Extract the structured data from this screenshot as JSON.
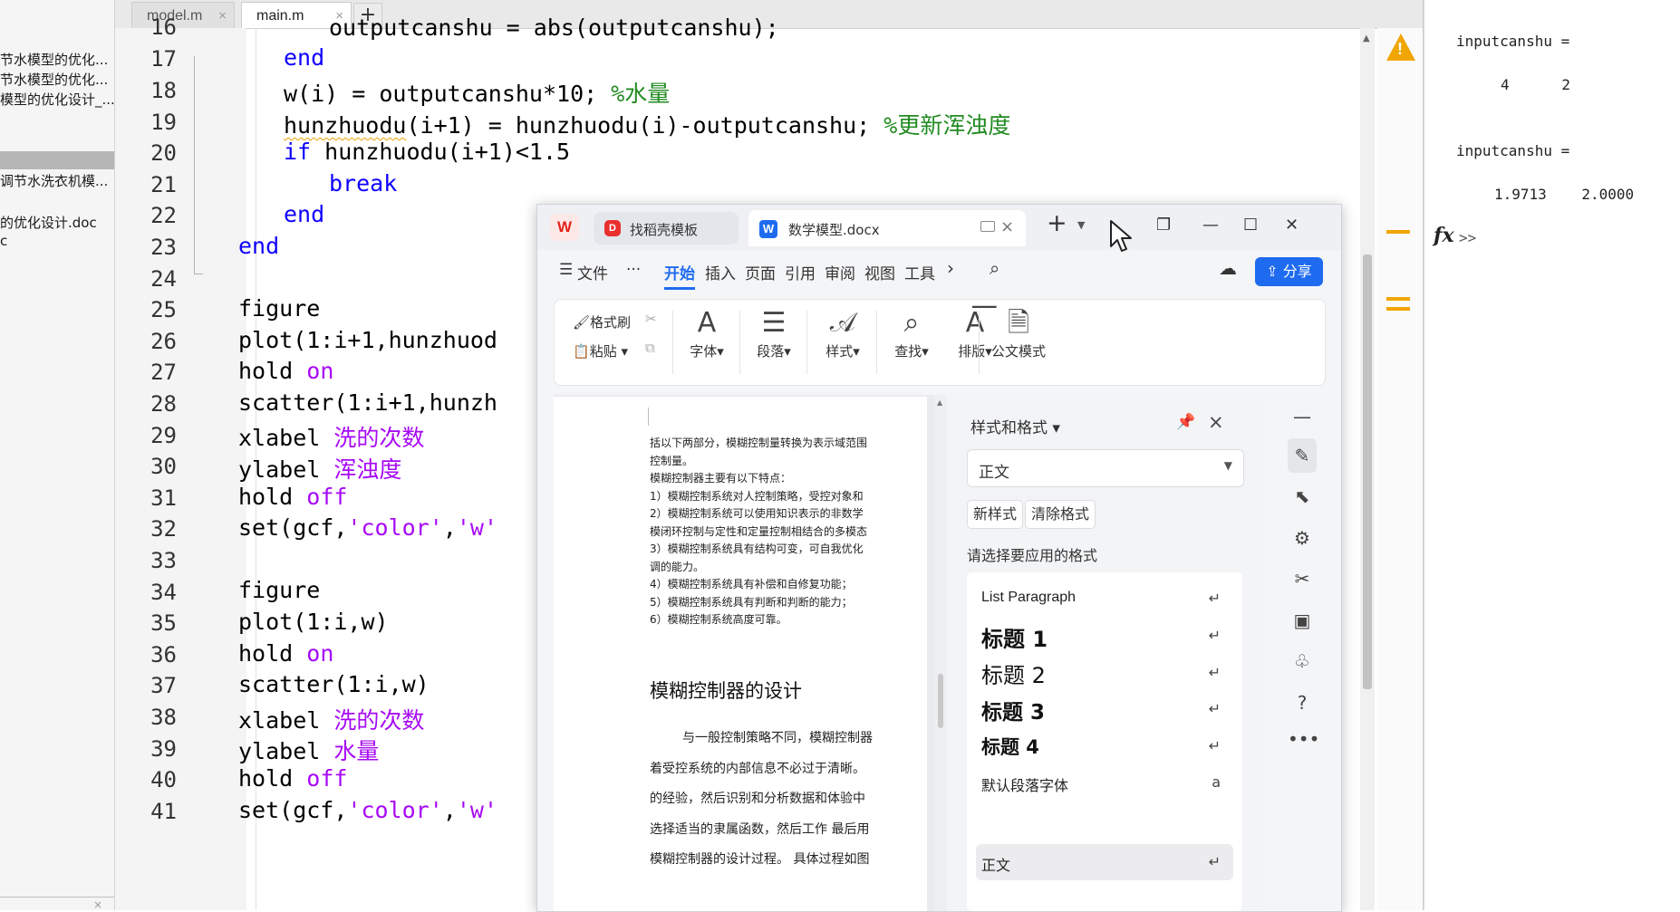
{
  "file_browser": {
    "items": [
      "节水模型的优化...",
      "节水模型的优化...",
      "模型的优化设计_...",
      "调节水洗衣机模...",
      "的优化设计.doc",
      "c"
    ],
    "close_symbol": "×"
  },
  "editor": {
    "tabs": [
      {
        "label": "model.m",
        "close": "×"
      },
      {
        "label": "main.m",
        "close": "×"
      }
    ],
    "new_tab_symbol": "+",
    "line_numbers": [
      "16",
      "17",
      "18",
      "19",
      "20",
      "21",
      "22",
      "23",
      "24",
      "25",
      "26",
      "27",
      "28",
      "29",
      "30",
      "31",
      "32",
      "33",
      "34",
      "35",
      "36",
      "37",
      "38",
      "39",
      "40",
      "41"
    ],
    "code": {
      "l16": "outputcanshu = abs(outputcanshu);",
      "l17_kw": "end",
      "l18_code": "w(i) = outputcanshu*10; ",
      "l18_comment": "%水量",
      "l19_var": "hunzhuodu",
      "l19_code": "(i+1) = hunzhuodu(i)-outputcanshu; ",
      "l19_comment": "%更新浑浊度",
      "l20_kw": "if",
      "l20_code": " hunzhuodu(i+1)<1.5",
      "l21_kw": "break",
      "l22_kw": "end",
      "l23_kw": "end",
      "l25": "figure",
      "l26": "plot(1:i+1,hunzhuod",
      "l27_code": "hold ",
      "l27_str": "on",
      "l28": "scatter(1:i+1,hunzh",
      "l29_code": "xlabel ",
      "l29_str": "洗的次数",
      "l30_code": "ylabel ",
      "l30_str": "浑浊度",
      "l31_code": "hold ",
      "l31_str": "off",
      "l32_a": "set(gcf,",
      "l32_s1": "'color'",
      "l32_b": ",",
      "l32_s2": "'w'",
      "l34": "figure",
      "l35": "plot(1:i,w)",
      "l36_code": "hold ",
      "l36_str": "on",
      "l37": "scatter(1:i,w)",
      "l38_code": "xlabel ",
      "l38_str": "洗的次数",
      "l39_code": "ylabel ",
      "l39_str": "水量",
      "l40_code": "hold ",
      "l40_str": "off",
      "l41_a": "set(gcf,",
      "l41_s1": "'color'",
      "l41_b": ",",
      "l41_s2": "'w'"
    },
    "warning_symbol": "!"
  },
  "command_window": {
    "var1_label": "inputcanshu =",
    "var1_values": "4      2",
    "var2_label": "inputcanshu =",
    "var2_values": "1.9713    2.0000",
    "fx_label": "fx",
    "prompt": ">>"
  },
  "wps": {
    "logo": "W",
    "tabs": [
      {
        "icon": "D",
        "label": "找稻壳模板"
      },
      {
        "icon": "W",
        "label": "数学模型.docx",
        "close": "×"
      }
    ],
    "new_tab": "+",
    "window_controls": {
      "restore_tabs": "❐",
      "minimize": "—",
      "maximize": "☐",
      "close": "✕"
    },
    "ribbon_tabs": [
      "文件",
      "···",
      "开始",
      "插入",
      "页面",
      "引用",
      "审阅",
      "视图",
      "工具"
    ],
    "ribbon_menu_icon": "☰",
    "ribbon_more": "›",
    "share_label": "分享",
    "toolbar": {
      "format_painter": "格式刷",
      "paste": "粘贴",
      "font": "字体",
      "paragraph": "段落",
      "style": "样式",
      "find": "查找",
      "layout": "排版",
      "official_doc": "公文模式"
    },
    "document": {
      "lines": [
        "括以下两部分，模糊控制量转换为表示域范围",
        "控制量。",
        "模糊控制器主要有以下特点：",
        "1）模糊控制系统对人控制策略，受控对象和",
        "2）模糊控制系统可以使用知识表示的非数学",
        "模闭环控制与定性和定量控制相结合的多模态",
        "3）模糊控制系统具有结构可变，可自我优化",
        "调的能力。",
        "4）模糊控制系统具有补偿和自修复功能；",
        "5）模糊控制系统具有判断和判断的能力；",
        "6）模糊控制系统高度可靠。"
      ],
      "heading": "模糊控制器的设计",
      "body": [
        "与一般控制策略不同，模糊控制器",
        "着受控系统的内部信息不必过于清晰。",
        "的经验，然后识别和分析数据和体验中",
        "选择适当的隶属函数，然后工作 最后用",
        "模糊控制器的设计过程。 具体过程如图"
      ]
    },
    "styles_pane": {
      "title": "样式和格式",
      "current_style": "正文",
      "new_style": "新样式",
      "clear_format": "清除格式",
      "apply_label": "请选择要应用的格式",
      "items": [
        {
          "label": "List Paragraph",
          "mark": "↵"
        },
        {
          "label": "标题  1",
          "mark": "↵"
        },
        {
          "label": "标题  2",
          "mark": "↵"
        },
        {
          "label": "标题  3",
          "mark": "↵"
        },
        {
          "label": "标题  4",
          "mark": "↵"
        },
        {
          "label": "默认段落字体",
          "mark": "a"
        },
        {
          "label": "正文",
          "mark": "↵"
        }
      ]
    }
  }
}
